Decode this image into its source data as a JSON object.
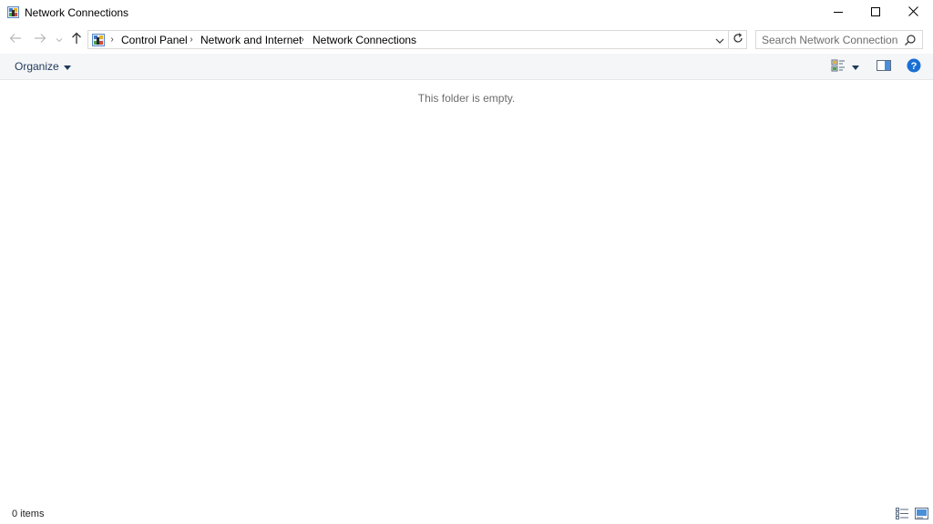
{
  "window": {
    "title": "Network Connections",
    "app_icon": "network-connections-icon"
  },
  "title_buttons": {
    "minimize": "minimize-icon",
    "maximize": "maximize-icon",
    "close": "close-icon"
  },
  "nav": {
    "back": "arrow-left-icon",
    "forward": "arrow-right-icon",
    "recent": "chevron-down-icon",
    "up": "arrow-up-icon"
  },
  "address": {
    "location_icon": "control-panel-icon",
    "breadcrumbs": [
      "Control Panel",
      "Network and Internet",
      "Network Connections"
    ],
    "separator": "›"
  },
  "search": {
    "placeholder": "Search Network Connections",
    "value": ""
  },
  "toolbar": {
    "organize_label": "Organize"
  },
  "content": {
    "empty_message": "This folder is empty."
  },
  "status": {
    "item_count": "0 items"
  },
  "colors": {
    "accent_link": "#1e395b",
    "help_blue": "#1a6fd4",
    "cmdbar_bg": "#f5f6f7",
    "muted_text": "#6d6d6d"
  }
}
